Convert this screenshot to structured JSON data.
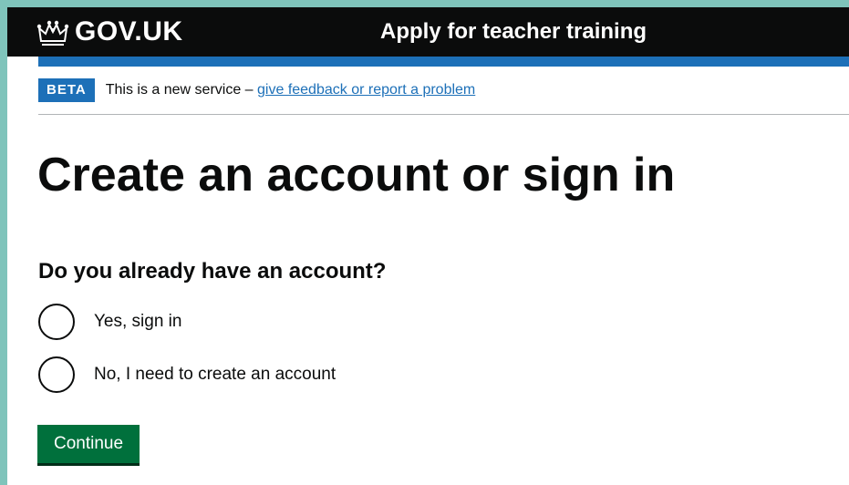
{
  "header": {
    "logo_text": "GOV.UK",
    "logo_icon": "crown-icon",
    "service_name": "Apply for teacher training"
  },
  "phase_banner": {
    "tag": "BETA",
    "text": "This is a new service – ",
    "link_text": "give feedback or report a problem"
  },
  "main": {
    "title": "Create an account or sign in",
    "question": "Do you already have an account?",
    "options": [
      {
        "label": "Yes, sign in",
        "selected": false
      },
      {
        "label": "No, I need to create an account",
        "selected": false
      }
    ],
    "continue_label": "Continue"
  },
  "colors": {
    "header_background": "#0b0c0c",
    "brand_blue": "#1d70b8",
    "button_green": "#00703c",
    "text": "#0b0c0c",
    "page_border": "#7fc4bb"
  }
}
